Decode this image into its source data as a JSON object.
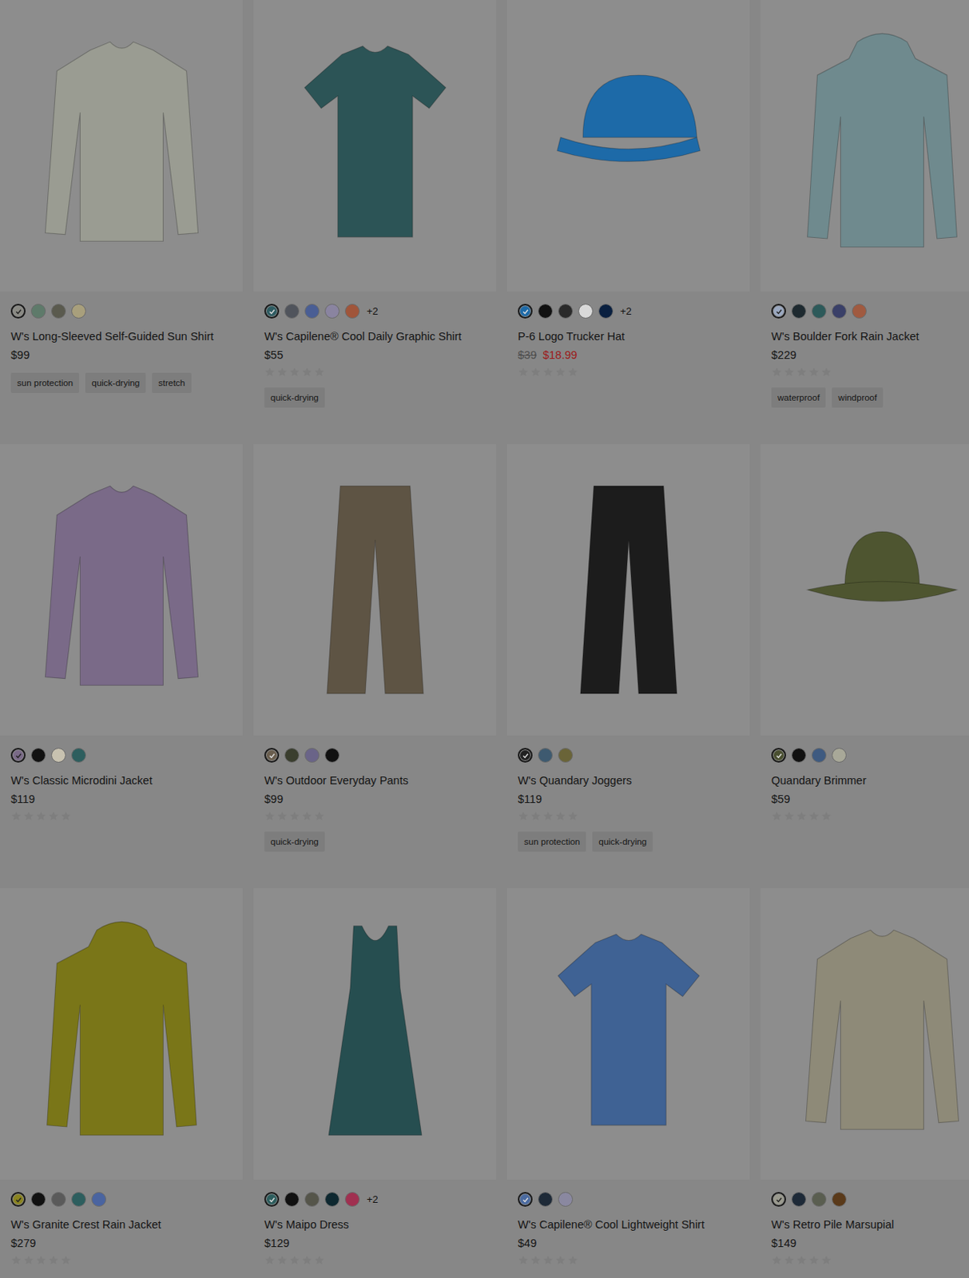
{
  "backdrop": {
    "dimmed": true
  },
  "products": [
    {
      "name": "W's Long-Sleeved Self-Guided Sun Shirt",
      "price": "$99",
      "original_price": "",
      "sale": false,
      "shape": "longsleeve",
      "color": "#9a9c92",
      "swatches": [
        {
          "color": "#8a8a84",
          "selected": true
        },
        {
          "color": "#5e7a6a",
          "selected": false
        },
        {
          "color": "#5a5a4e",
          "selected": false
        },
        {
          "color": "#a89f7c",
          "selected": false
        }
      ],
      "more": "",
      "rating": {
        "shown": false,
        "stars": 0
      },
      "tags": [
        "sun protection",
        "quick-drying",
        "stretch"
      ]
    },
    {
      "name": "W's Capilene® Cool Daily Graphic Shirt",
      "price": "$55",
      "original_price": "",
      "sale": false,
      "shape": "tee",
      "color": "#2c5456",
      "swatches": [
        {
          "color": "#2f5d63",
          "selected": true
        },
        {
          "color": "#50545c",
          "selected": false
        },
        {
          "color": "#4a5e94",
          "selected": false
        },
        {
          "color": "#8a84a0",
          "selected": false
        },
        {
          "color": "#a0553a",
          "selected": false
        }
      ],
      "more": "+2",
      "rating": {
        "shown": true,
        "stars": 0
      },
      "tags": [
        "quick-drying"
      ]
    },
    {
      "name": "P-6 Logo Trucker Hat",
      "price": "$18.99",
      "original_price": "$39",
      "sale": true,
      "shape": "cap",
      "color": "#1d6aa8",
      "swatches": [
        {
          "color": "#1d6aa8",
          "selected": true
        },
        {
          "color": "#111111",
          "selected": false
        },
        {
          "color": "#2a2a2a",
          "selected": false
        },
        {
          "color": "#d9d9d9",
          "selected": false
        },
        {
          "color": "#0a2040",
          "selected": false
        }
      ],
      "more": "+2",
      "rating": {
        "shown": true,
        "stars": 0
      },
      "tags": []
    },
    {
      "name": "W's Boulder Fork Rain Jacket",
      "price": "$229",
      "original_price": "",
      "sale": false,
      "shape": "jacket",
      "color": "#6f8a8e",
      "swatches": [
        {
          "color": "#9aa8c0",
          "selected": true
        },
        {
          "color": "#1e2a30",
          "selected": false
        },
        {
          "color": "#2d5a5a",
          "selected": false
        },
        {
          "color": "#3a4068",
          "selected": false
        },
        {
          "color": "#a05a40",
          "selected": false
        }
      ],
      "more": "",
      "rating": {
        "shown": true,
        "stars": 0
      },
      "tags": [
        "waterproof",
        "windproof"
      ]
    },
    {
      "name": "W's Classic Microdini Jacket",
      "price": "$119",
      "original_price": "",
      "sale": false,
      "shape": "longsleeve",
      "color": "#7a6a88",
      "swatches": [
        {
          "color": "#7a6a88",
          "selected": true
        },
        {
          "color": "#111111",
          "selected": false
        },
        {
          "color": "#c8c2b0",
          "selected": false
        },
        {
          "color": "#2d5e5e",
          "selected": false
        }
      ],
      "more": "",
      "rating": {
        "shown": true,
        "stars": 0
      },
      "tags": []
    },
    {
      "name": "W's Outdoor Everyday Pants",
      "price": "$99",
      "original_price": "",
      "sale": false,
      "shape": "pants",
      "color": "#5e5444",
      "swatches": [
        {
          "color": "#6a5e4e",
          "selected": true
        },
        {
          "color": "#3a3e2e",
          "selected": false
        },
        {
          "color": "#6a6488",
          "selected": false
        },
        {
          "color": "#111111",
          "selected": false
        }
      ],
      "more": "",
      "rating": {
        "shown": true,
        "stars": 0
      },
      "tags": [
        "quick-drying"
      ]
    },
    {
      "name": "W's Quandary Joggers",
      "price": "$119",
      "original_price": "",
      "sale": false,
      "shape": "pants",
      "color": "#1c1c1c",
      "swatches": [
        {
          "color": "#222222",
          "selected": true
        },
        {
          "color": "#3e5a70",
          "selected": false
        },
        {
          "color": "#6a6438",
          "selected": false
        }
      ],
      "more": "",
      "rating": {
        "shown": true,
        "stars": 0
      },
      "tags": [
        "sun protection",
        "quick-drying"
      ]
    },
    {
      "name": "Quandary Brimmer",
      "price": "$59",
      "original_price": "",
      "sale": false,
      "shape": "brimmer",
      "color": "#4e5530",
      "swatches": [
        {
          "color": "#4a5030",
          "selected": true
        },
        {
          "color": "#111111",
          "selected": false
        },
        {
          "color": "#3e5a80",
          "selected": false
        },
        {
          "color": "#a8a898",
          "selected": false
        }
      ],
      "more": "",
      "rating": {
        "shown": true,
        "stars": 0
      },
      "tags": []
    },
    {
      "name": "W's Granite Crest Rain Jacket",
      "price": "$279",
      "original_price": "",
      "sale": false,
      "shape": "jacket",
      "color": "#7a7618",
      "swatches": [
        {
          "color": "#8a8420",
          "selected": true
        },
        {
          "color": "#111111",
          "selected": false
        },
        {
          "color": "#5a5a5a",
          "selected": false
        },
        {
          "color": "#2d5e5e",
          "selected": false
        },
        {
          "color": "#4a64a0",
          "selected": false
        }
      ],
      "more": "",
      "rating": {
        "shown": true,
        "stars": 0
      },
      "tags": []
    },
    {
      "name": "W's Maipo Dress",
      "price": "$129",
      "original_price": "",
      "sale": false,
      "shape": "dress",
      "color": "#264e50",
      "swatches": [
        {
          "color": "#2d5e5e",
          "selected": true
        },
        {
          "color": "#111111",
          "selected": false
        },
        {
          "color": "#55554a",
          "selected": false
        },
        {
          "color": "#0e2830",
          "selected": false
        },
        {
          "color": "#a03050",
          "selected": false
        }
      ],
      "more": "+2",
      "rating": {
        "shown": true,
        "stars": 0
      },
      "tags": []
    },
    {
      "name": "W's Capilene® Cool Lightweight Shirt",
      "price": "$49",
      "original_price": "",
      "sale": false,
      "shape": "tee",
      "color": "#3f6294",
      "swatches": [
        {
          "color": "#4a6aa0",
          "selected": true
        },
        {
          "color": "#1e2a38",
          "selected": false
        },
        {
          "color": "#8a88a0",
          "selected": false
        }
      ],
      "more": "",
      "rating": {
        "shown": true,
        "stars": 0
      },
      "tags": []
    },
    {
      "name": "W's Retro Pile Marsupial",
      "price": "$149",
      "original_price": "",
      "sale": false,
      "shape": "longsleeve",
      "color": "#8e8a78",
      "swatches": [
        {
          "color": "#9a9a8e",
          "selected": true
        },
        {
          "color": "#1e2a38",
          "selected": false
        },
        {
          "color": "#5a5e50",
          "selected": false
        },
        {
          "color": "#5a3a1a",
          "selected": false
        }
      ],
      "more": "",
      "rating": {
        "shown": true,
        "stars": 0
      },
      "tags": []
    }
  ]
}
